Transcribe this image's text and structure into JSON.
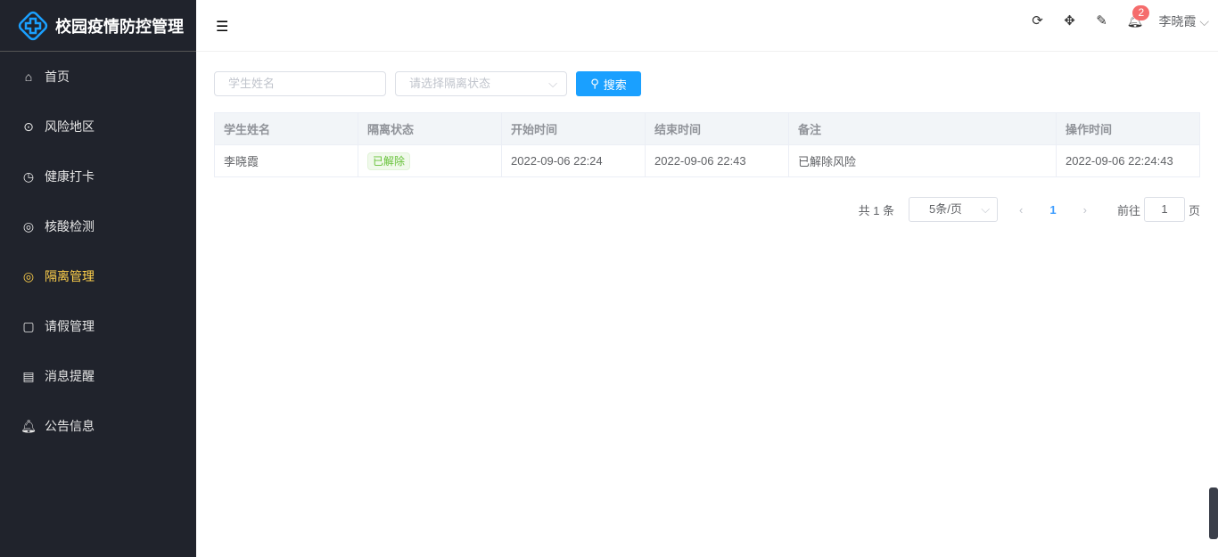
{
  "app": {
    "title": "校园疫情防控管理"
  },
  "sidebar": {
    "items": [
      {
        "label": "首页",
        "icon": "home-icon"
      },
      {
        "label": "风险地区",
        "icon": "location-icon"
      },
      {
        "label": "健康打卡",
        "icon": "stopwatch-icon"
      },
      {
        "label": "核酸检测",
        "icon": "chart-icon"
      },
      {
        "label": "隔离管理",
        "icon": "lifebuoy-icon",
        "active": true
      },
      {
        "label": "请假管理",
        "icon": "document-icon"
      },
      {
        "label": "消息提醒",
        "icon": "message-icon"
      },
      {
        "label": "公告信息",
        "icon": "bell-icon"
      }
    ]
  },
  "header": {
    "notification_count": "2",
    "user": "李晓霞"
  },
  "filters": {
    "name_placeholder": "学生姓名",
    "status_placeholder": "请选择隔离状态",
    "search_label": "搜索"
  },
  "table": {
    "columns": [
      "学生姓名",
      "隔离状态",
      "开始时间",
      "结束时间",
      "备注",
      "操作时间"
    ],
    "rows": [
      [
        "李晓霞",
        "已解除",
        "2022-09-06 22:24",
        "2022-09-06 22:43",
        "已解除风险",
        "2022-09-06 22:24:43"
      ]
    ]
  },
  "pagination": {
    "total": "共 1 条",
    "page_size": "5条/页",
    "current": "1",
    "goto_label": "前往",
    "goto_value": "1",
    "page_suffix": "页"
  },
  "colors": {
    "sidebar": "#20232c",
    "active": "#ffd04b",
    "primary": "#1aa0ff"
  }
}
